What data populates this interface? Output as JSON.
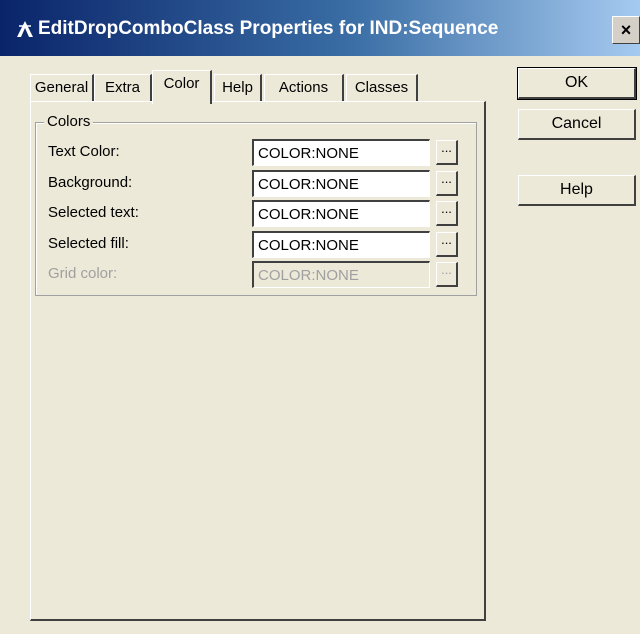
{
  "window": {
    "title": "EditDropComboClass Properties for IND:Sequence",
    "close_glyph": "×",
    "title_gradient": [
      "#0a246a",
      "#a6caf0"
    ]
  },
  "buttons": {
    "ok": "OK",
    "cancel": "Cancel",
    "help": "Help"
  },
  "tabs": [
    {
      "label": "General"
    },
    {
      "label": "Extra"
    },
    {
      "label": "Color"
    },
    {
      "label": "Help"
    },
    {
      "label": "Actions"
    },
    {
      "label": "Classes"
    }
  ],
  "active_tab": "Color",
  "group": {
    "label": "Colors",
    "rows": [
      {
        "label": "Text Color:",
        "value": "COLOR:NONE",
        "button": "...",
        "enabled": true
      },
      {
        "label": "Background:",
        "value": "COLOR:NONE",
        "button": "...",
        "enabled": true
      },
      {
        "label": "Selected text:",
        "value": "COLOR:NONE",
        "button": "...",
        "enabled": true
      },
      {
        "label": "Selected fill:",
        "value": "COLOR:NONE",
        "button": "...",
        "enabled": true
      },
      {
        "label": "Grid color:",
        "value": "COLOR:NONE",
        "button": "...",
        "enabled": false
      }
    ]
  }
}
